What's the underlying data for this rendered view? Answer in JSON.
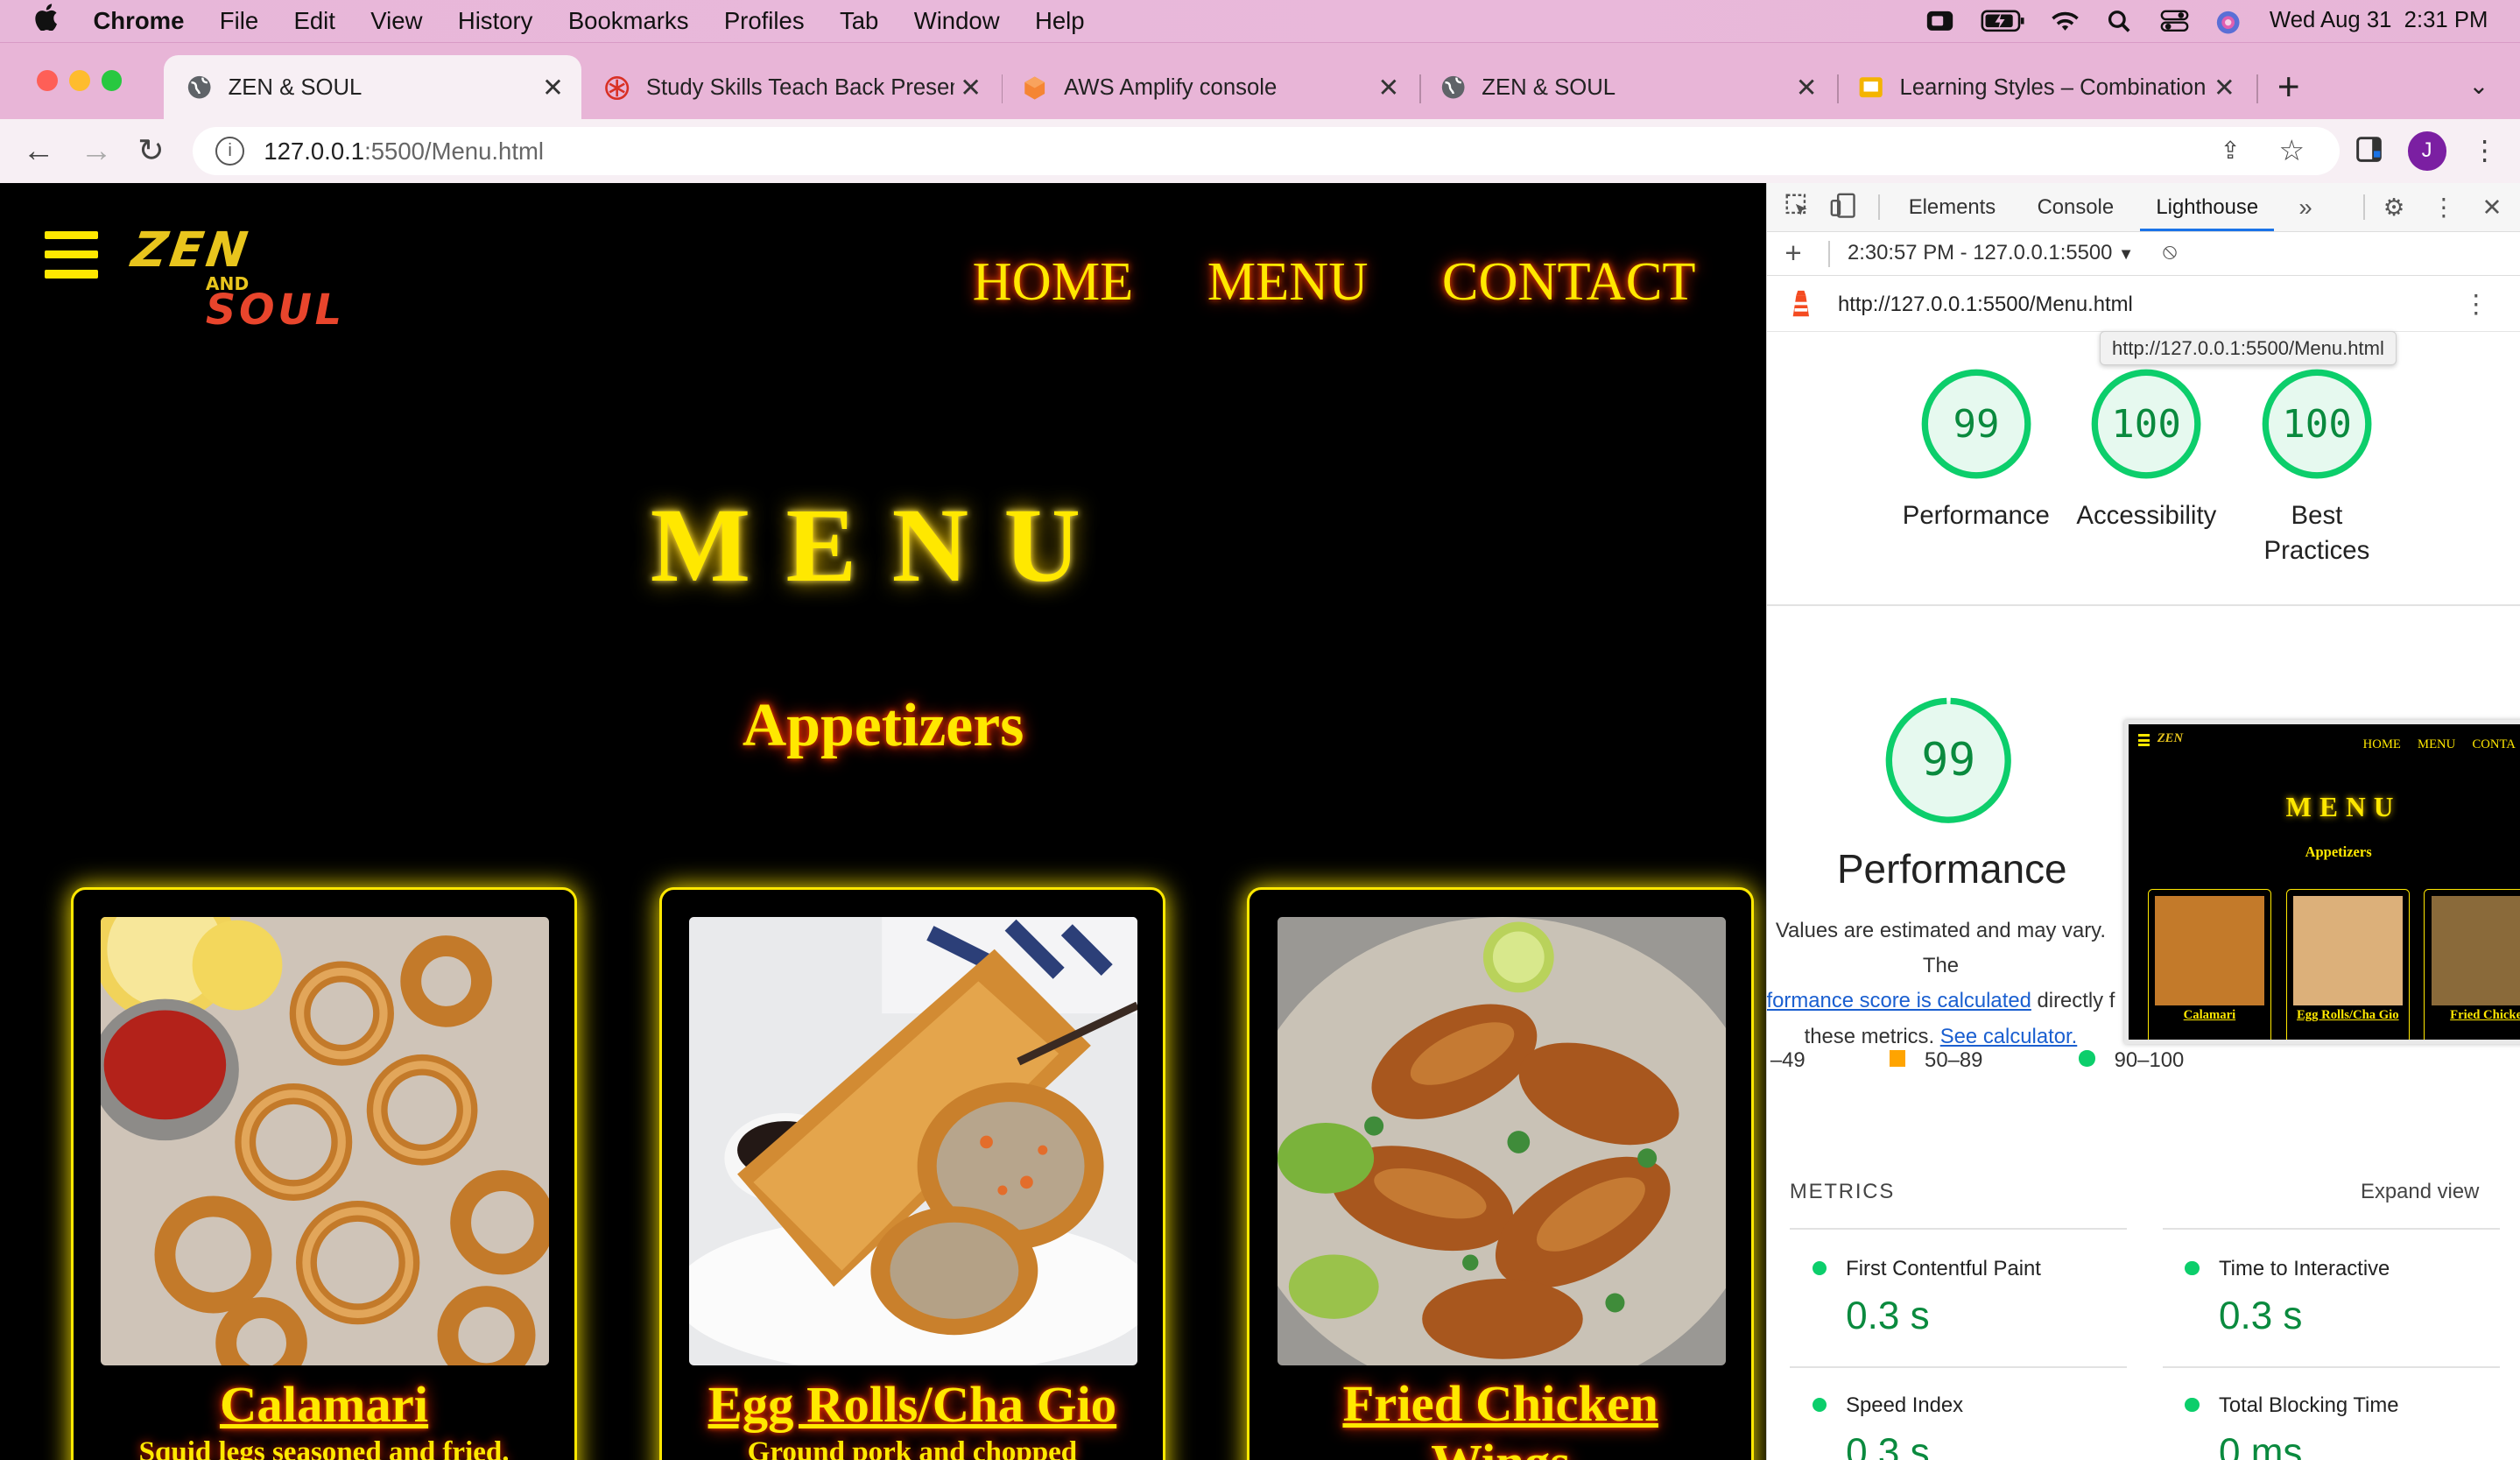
{
  "menubar": {
    "app": "Chrome",
    "items": [
      "File",
      "Edit",
      "View",
      "History",
      "Bookmarks",
      "Profiles",
      "Tab",
      "Window",
      "Help"
    ],
    "clock": "Wed Aug 31  2:31 PM"
  },
  "tabs": [
    {
      "title": "ZEN & SOUL",
      "icon": "globe-icon"
    },
    {
      "title": "Study Skills Teach Back Presen",
      "icon": "asterisk-icon"
    },
    {
      "title": "AWS Amplify console",
      "icon": "aws-icon"
    },
    {
      "title": "ZEN & SOUL",
      "icon": "globe-icon"
    },
    {
      "title": "Learning Styles – Combination",
      "icon": "slides-icon"
    }
  ],
  "address": {
    "url": "127.0.0.1:5500/Menu.html",
    "url_host": "127.0.0.1",
    "url_rest": ":5500/Menu.html"
  },
  "site": {
    "logo_line1": "ZEN",
    "logo_and": "AND",
    "logo_line2": "SOUL",
    "nav": [
      "HOME",
      "MENU",
      "CONTACT"
    ],
    "heading": "MENU",
    "section": "Appetizers",
    "cards": [
      {
        "name": "Calamari",
        "desc": "Squid legs seasoned and fried."
      },
      {
        "name": "Egg Rolls/Cha Gio",
        "desc": "Ground pork and chopped"
      },
      {
        "name": "Fried Chicken",
        "name2": "Wings",
        "desc": ""
      }
    ]
  },
  "devtools": {
    "tabs": [
      "Elements",
      "Console",
      "Lighthouse"
    ],
    "active_tab": "Lighthouse",
    "report_time": "2:30:57 PM - 127.0.0.1:5500",
    "report_url": "http://127.0.0.1:5500/Menu.html",
    "tooltip": "http://127.0.0.1:5500/Menu.html",
    "scores": [
      {
        "label": "Performance",
        "value": "99"
      },
      {
        "label": "Accessibility",
        "value": "100"
      },
      {
        "label": "Best Practices",
        "label1": "Best",
        "label2": "Practices",
        "value": "100"
      }
    ],
    "perf_score": "99",
    "perf_label": "Performance",
    "perf_text_1": "Values are estimated and may vary. The",
    "perf_link_1": "formance score is calculated",
    "perf_text_2": " directly f",
    "perf_text_3": "these metrics. ",
    "perf_link_2": "See calculator.",
    "legend": [
      "–49",
      "50–89",
      "90–100"
    ],
    "metrics_heading": "METRICS",
    "expand": "Expand view",
    "metrics": [
      {
        "label": "First Contentful Paint",
        "value": "0.3 s"
      },
      {
        "label": "Time to Interactive",
        "value": "0.3 s"
      },
      {
        "label": "Speed Index",
        "value": "0.3 s"
      },
      {
        "label": "Total Blocking Time",
        "value": "0 ms"
      }
    ],
    "thumb": {
      "nav": [
        "HOME",
        "MENU",
        "CONTA"
      ],
      "heading": "MENU",
      "section": "Appetizers",
      "cards": [
        "Calamari",
        "Egg Rolls/Cha Gio",
        "Fried Chicke"
      ]
    }
  },
  "colors": {
    "neon_yellow": "#ffe800",
    "glow_red": "#ff2a00",
    "score_green": "#0cce6b",
    "score_orange": "#ffa400"
  }
}
